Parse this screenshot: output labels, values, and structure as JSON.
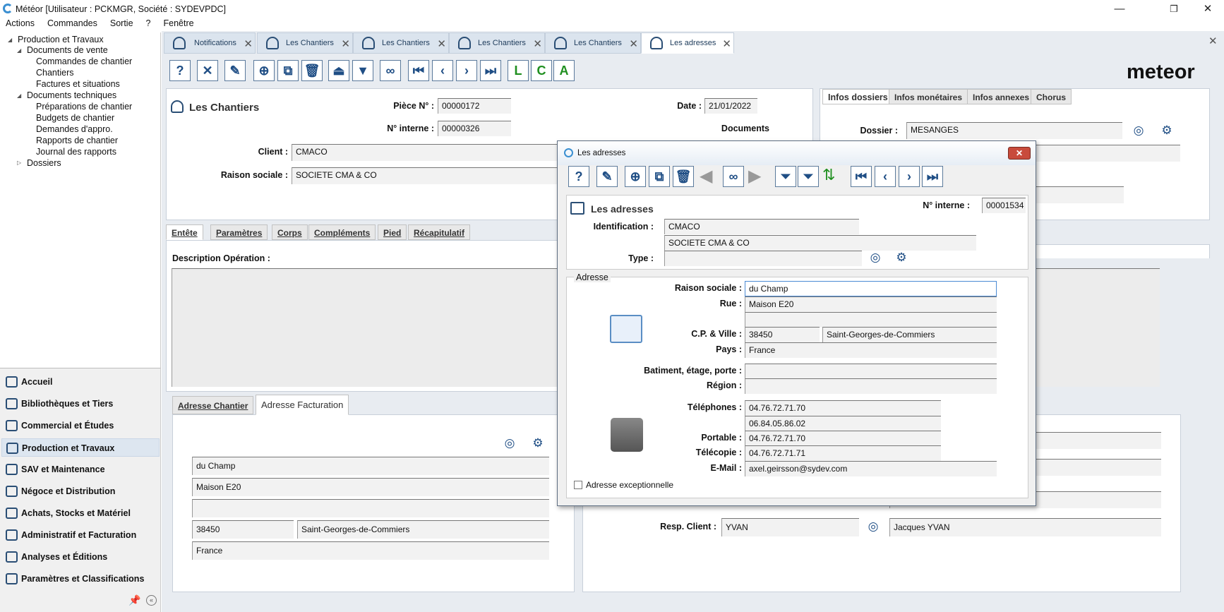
{
  "window": {
    "title": "Météor [Utilisateur : PCKMGR, Société : SYDEVPDC]"
  },
  "menubar": [
    "Actions",
    "Commandes",
    "Sortie",
    "?",
    "Fenêtre"
  ],
  "tree": [
    {
      "label": "Production et Travaux",
      "level": 0
    },
    {
      "label": "Documents de vente",
      "level": 1
    },
    {
      "label": "Commandes de chantier",
      "level": 2
    },
    {
      "label": "Chantiers",
      "level": 2
    },
    {
      "label": "Factures et situations",
      "level": 2
    },
    {
      "label": "Documents techniques",
      "level": 1
    },
    {
      "label": "Préparations de chantier",
      "level": 2
    },
    {
      "label": "Budgets de chantier",
      "level": 2
    },
    {
      "label": "Demandes d'appro.",
      "level": 2
    },
    {
      "label": "Rapports de chantier",
      "level": 2
    },
    {
      "label": "Journal des rapports",
      "level": 2
    },
    {
      "label": "Dossiers",
      "level": 1
    }
  ],
  "nav": [
    {
      "label": "Accueil",
      "icon": "home-icon"
    },
    {
      "label": "Bibliothèques et Tiers",
      "icon": "books-icon"
    },
    {
      "label": "Commercial et Études",
      "icon": "pencil-ruler-icon"
    },
    {
      "label": "Production et Travaux",
      "icon": "worker-icon",
      "selected": true
    },
    {
      "label": "SAV et Maintenance",
      "icon": "gear-wrench-icon"
    },
    {
      "label": "Négoce et Distribution",
      "icon": "boxes-icon"
    },
    {
      "label": "Achats, Stocks et Matériel",
      "icon": "cart-icon"
    },
    {
      "label": "Administratif et Facturation",
      "icon": "people-icon"
    },
    {
      "label": "Analyses et Éditions",
      "icon": "chart-icon"
    },
    {
      "label": "Paramètres et Classifications",
      "icon": "settings-icon"
    }
  ],
  "tabs": [
    "Notifications",
    "Les Chantiers",
    "Les Chantiers",
    "Les Chantiers",
    "Les Chantiers",
    "Les adresses"
  ],
  "brand": "meteor",
  "chantier": {
    "title": "Les Chantiers",
    "piece_label": "Pièce N° :",
    "piece": "00000172",
    "interne_label": "N° interne :",
    "interne": "00000326",
    "date_label": "Date :",
    "date": "21/01/2022",
    "documents": "Documents",
    "client_label": "Client :",
    "client": "CMACO",
    "raison_label": "Raison sociale :",
    "raison": "SOCIETE CMA & CO"
  },
  "right_tabs": [
    "Infos dossiers",
    "Infos monétaires",
    "Infos annexes",
    "Chorus"
  ],
  "dossier_label": "Dossier :",
  "dossier": "MESANGES",
  "sub_tabs": [
    "Entête",
    "Paramètres",
    "Corps",
    "Compléments",
    "Pied",
    "Récapitulatif"
  ],
  "desc_label": "Description Opération :",
  "addr_tabs": [
    "Adresse Chantier",
    "Adresse Facturation"
  ],
  "facturation": [
    "du Champ",
    "Maison E20",
    "",
    "38450",
    "Saint-Georges-de-Commiers",
    "France"
  ],
  "resp": {
    "label": "Resp. Client :",
    "code": "YVAN",
    "name": "Jacques YVAN"
  },
  "dialog": {
    "title": "Les adresses",
    "header_title": "Les adresses",
    "interne_label": "N° interne :",
    "interne": "00001534",
    "ident_label": "Identification :",
    "ident": "CMACO",
    "ident2": "SOCIETE CMA & CO",
    "type_label": "Type :",
    "type": "",
    "group": "Adresse",
    "raison_label": "Raison sociale :",
    "raison": "du Champ",
    "rue_label": "Rue :",
    "rue": "Maison E20",
    "rue2": "",
    "cp_label": "C.P. & Ville :",
    "cp": "38450",
    "ville": "Saint-Georges-de-Commiers",
    "pays_label": "Pays :",
    "pays": "France",
    "bat_label": "Batiment, étage, porte :",
    "bat": "",
    "region_label": "Région :",
    "region": "",
    "tel_label": "Téléphones :",
    "tel1": "04.76.72.71.70",
    "tel2": "06.84.05.86.02",
    "port_label": "Portable :",
    "port": "04.76.72.71.70",
    "fax_label": "Télécopie :",
    "fax": "04.76.72.71.71",
    "mail_label": "E-Mail :",
    "mail": "axel.geirsson@sydev.com",
    "exc_label": "Adresse exceptionnelle"
  }
}
